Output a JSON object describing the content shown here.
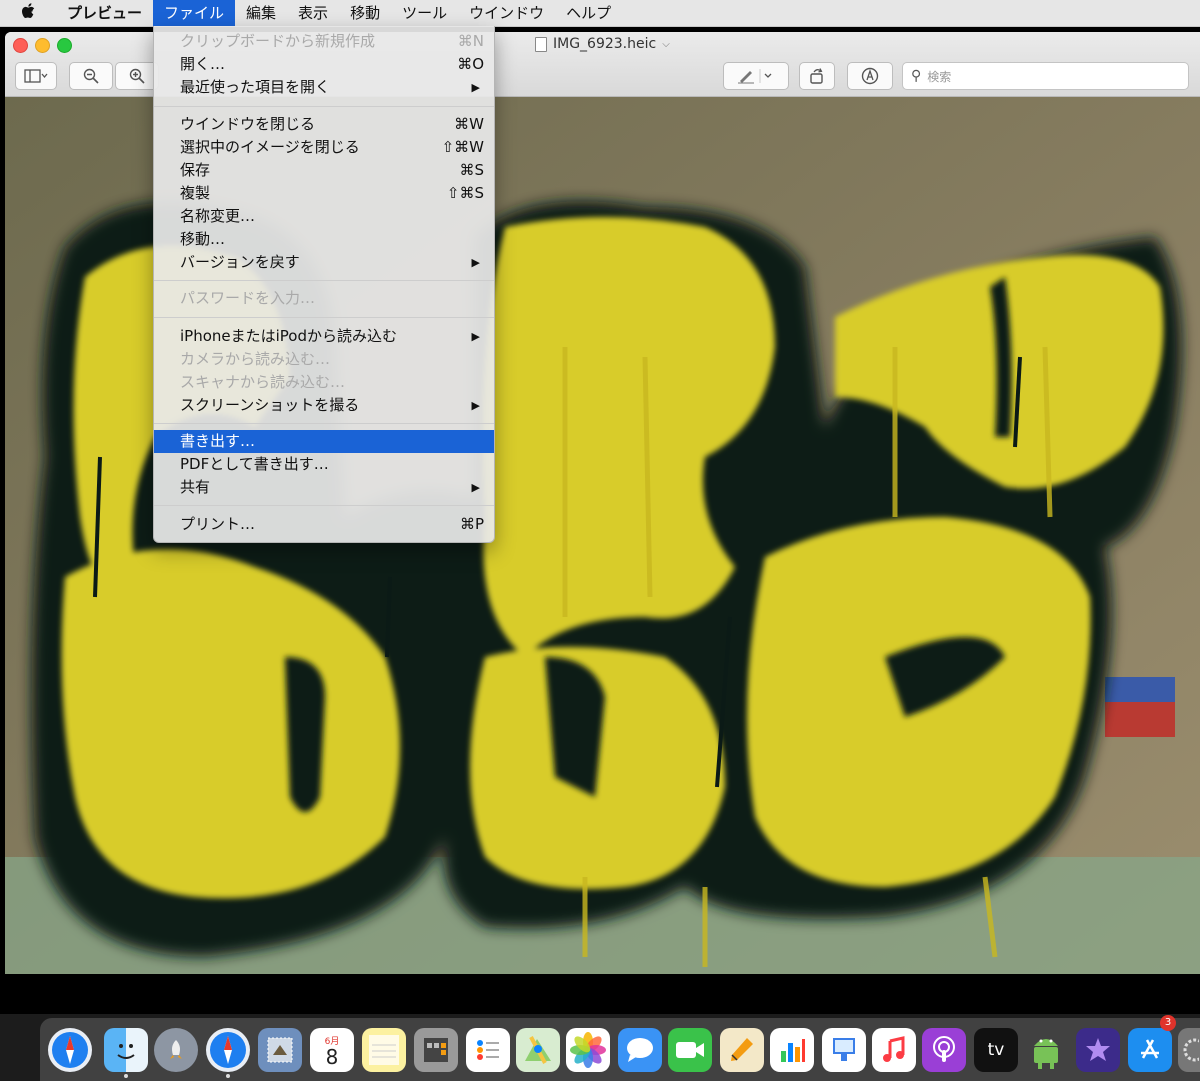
{
  "menubar": {
    "items": [
      "プレビュー",
      "ファイル",
      "編集",
      "表示",
      "移動",
      "ツール",
      "ウインドウ",
      "ヘルプ"
    ]
  },
  "window": {
    "title": "IMG_6923.heic",
    "search_placeholder": "検索"
  },
  "file_menu": {
    "items": [
      {
        "label": "クリップボードから新規作成",
        "shortcut": "⌘N",
        "disabled": true
      },
      {
        "label": "開く…",
        "shortcut": "⌘O"
      },
      {
        "label": "最近使った項目を開く",
        "submenu": true
      },
      {
        "label": "ウインドウを閉じる",
        "shortcut": "⌘W"
      },
      {
        "label": "選択中のイメージを閉じる",
        "shortcut": "⇧⌘W"
      },
      {
        "label": "保存",
        "shortcut": "⌘S"
      },
      {
        "label": "複製",
        "shortcut": "⇧⌘S"
      },
      {
        "label": "名称変更…"
      },
      {
        "label": "移動…"
      },
      {
        "label": "バージョンを戻す",
        "submenu": true
      },
      {
        "label": "パスワードを入力…",
        "disabled": true
      },
      {
        "label": "iPhoneまたはiPodから読み込む",
        "submenu": true
      },
      {
        "label": "カメラから読み込む…",
        "disabled": true
      },
      {
        "label": "スキャナから読み込む…",
        "disabled": true
      },
      {
        "label": "スクリーンショットを撮る",
        "submenu": true
      },
      {
        "label": "書き出す…",
        "highlighted": true
      },
      {
        "label": "PDFとして書き出す…"
      },
      {
        "label": "共有",
        "submenu": true
      },
      {
        "label": "プリント…",
        "shortcut": "⌘P"
      }
    ],
    "arrow_glyph": "▶"
  },
  "dock": {
    "calendar_month": "6月",
    "calendar_day": "8",
    "tv_label": "tv",
    "app_store_badge": "3"
  },
  "colors": {
    "menu_highlight": "#1a63d6",
    "graffiti_yellow": "#d8cc2a",
    "graffiti_outline": "#0b1a16"
  }
}
